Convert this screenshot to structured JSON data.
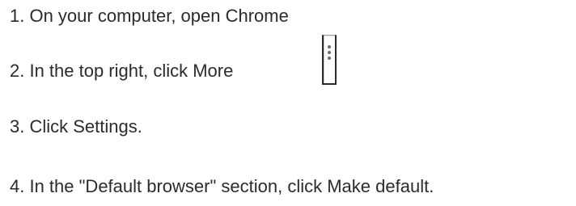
{
  "steps": [
    {
      "text": "1. On your computer, open Chrome"
    },
    {
      "text": "2. In the top right, click More"
    },
    {
      "text": "3. Click Settings."
    },
    {
      "text": "4. In the \"Default browser\" section, click Make default."
    }
  ],
  "icons": {
    "more": "more-vert-icon"
  }
}
